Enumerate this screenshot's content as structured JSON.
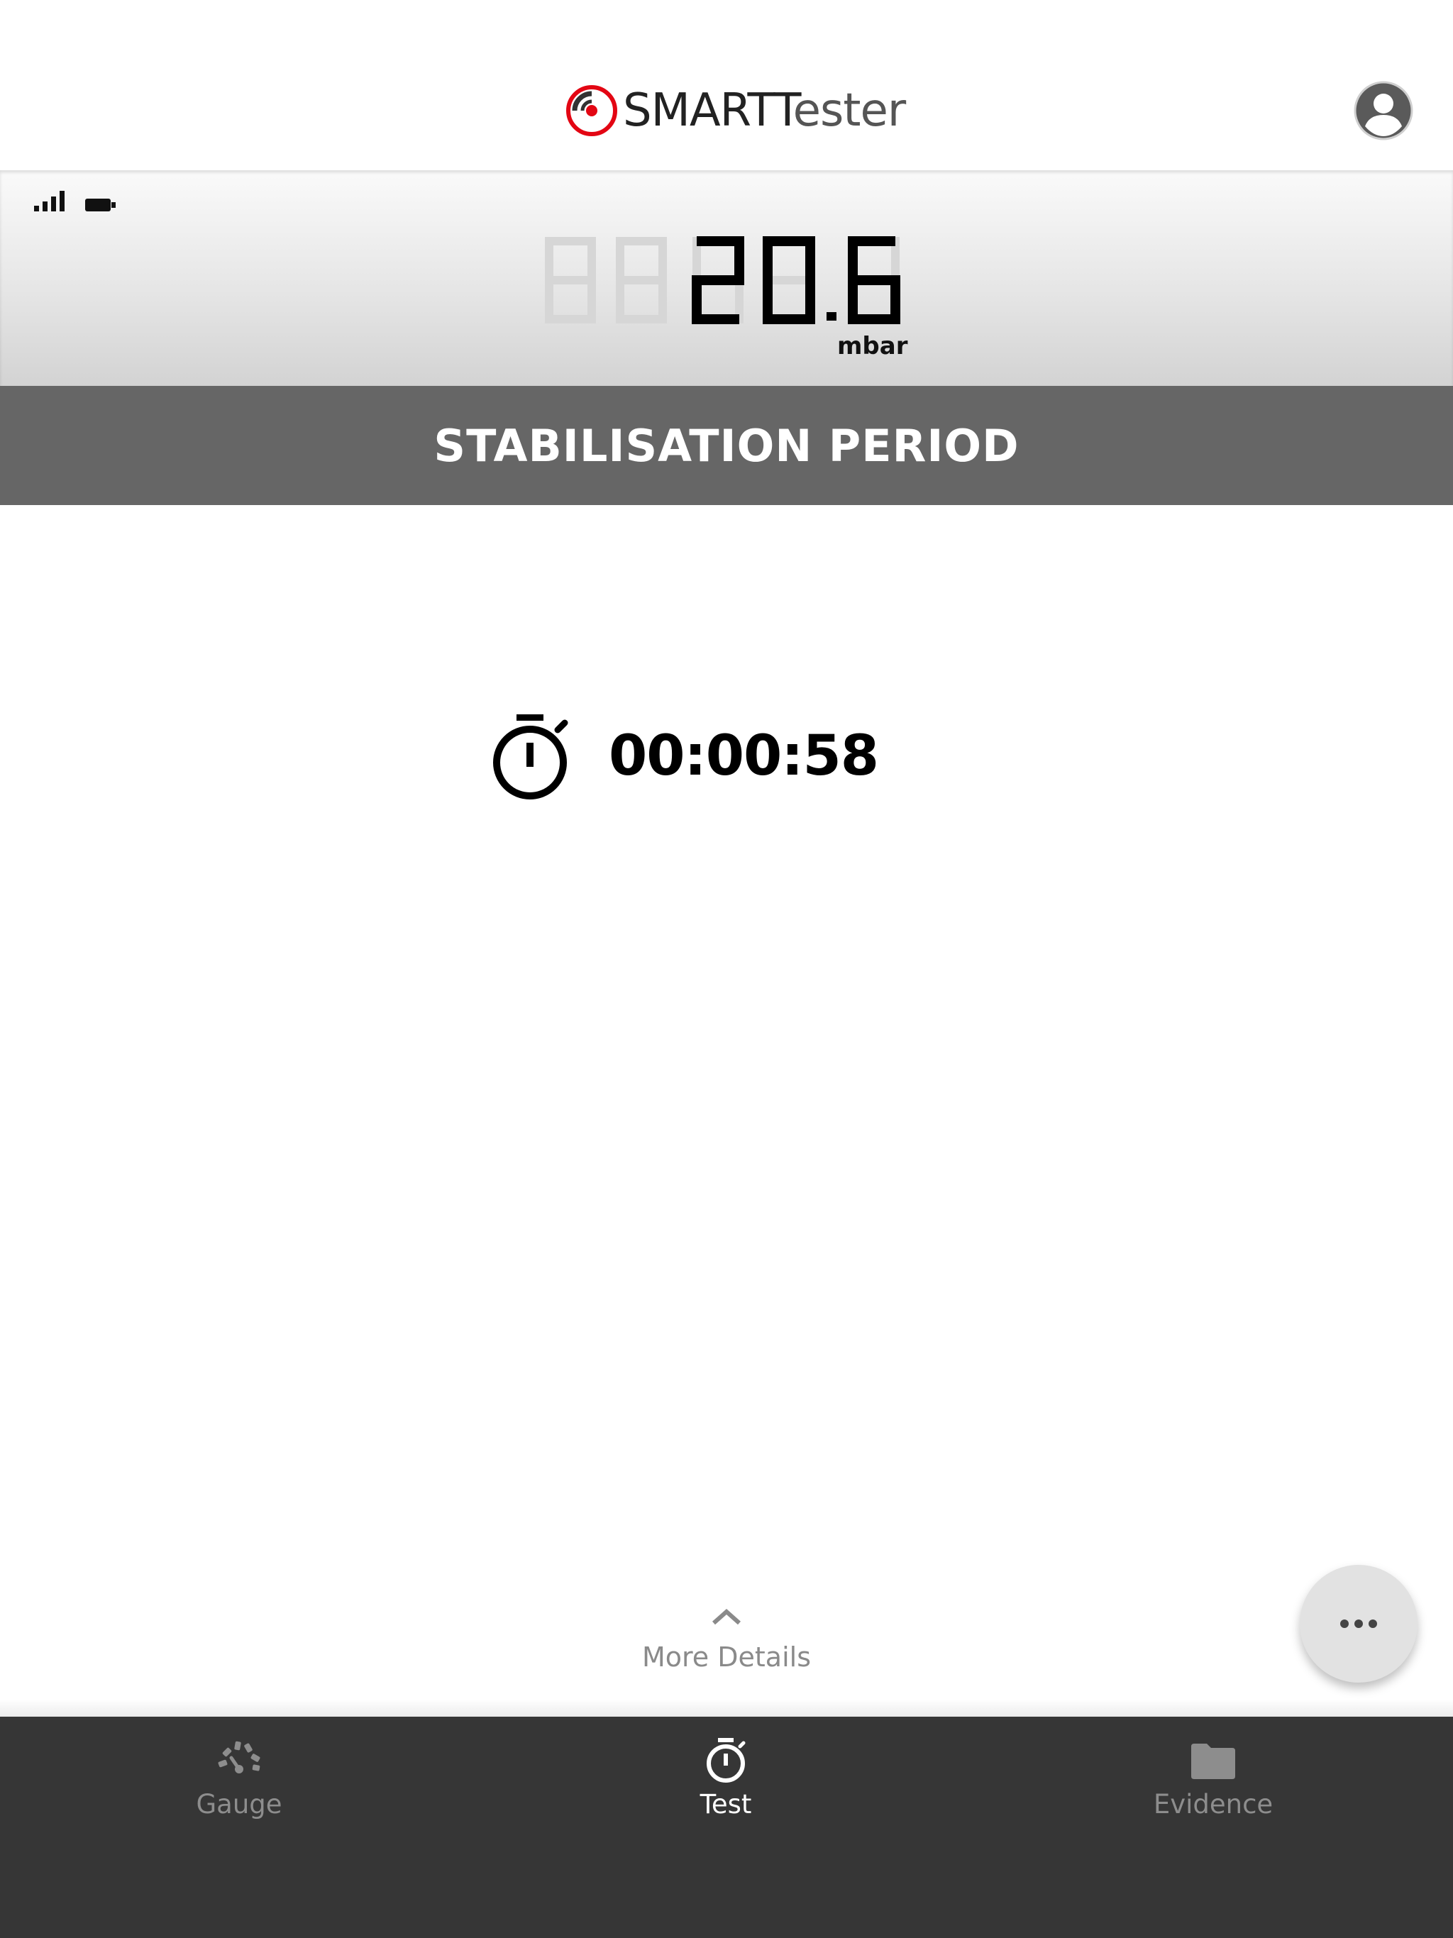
{
  "app": {
    "brand_bold": "SMART",
    "brand_light": "ester",
    "brand_accent": "#e30613"
  },
  "header": {
    "account_icon": "account-circle-icon"
  },
  "display": {
    "reading": "20.6",
    "unit": "mbar",
    "signal_icon": "signal-bars-icon",
    "battery_icon": "battery-icon"
  },
  "status": {
    "banner": "STABILISATION PERIOD",
    "banner_color": "#666666"
  },
  "timer": {
    "icon": "stopwatch-icon",
    "value": "00:00:58"
  },
  "details": {
    "label": "More Details",
    "icon": "chevron-up-icon"
  },
  "fab": {
    "icon": "more-horizontal-icon"
  },
  "nav": {
    "background": "#363636",
    "items": [
      {
        "label": "Gauge",
        "icon": "gauge-icon",
        "active": false
      },
      {
        "label": "Test",
        "icon": "stopwatch-icon",
        "active": true
      },
      {
        "label": "Evidence",
        "icon": "folder-icon",
        "active": false
      }
    ]
  }
}
